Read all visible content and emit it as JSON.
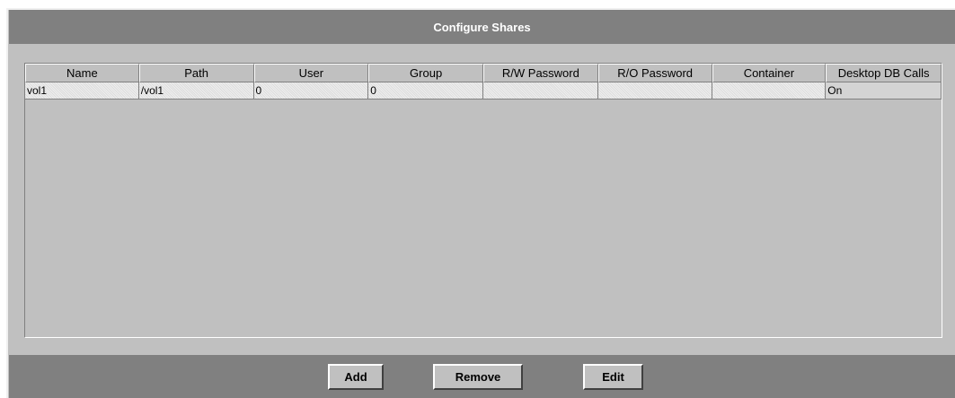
{
  "dialog": {
    "title": "Configure Shares"
  },
  "table": {
    "columns": [
      "Name",
      "Path",
      "User",
      "Group",
      "R/W Password",
      "R/O Password",
      "Container",
      "Desktop DB Calls"
    ],
    "rows": [
      [
        "vol1",
        "/vol1",
        "0",
        "0",
        "",
        "",
        "",
        "On"
      ]
    ]
  },
  "buttons": {
    "add": "Add",
    "remove": "Remove",
    "edit": "Edit"
  },
  "colors": {
    "title_bar": "#808080",
    "panel": "#c0c0c0",
    "title_text": "#ffffff"
  }
}
